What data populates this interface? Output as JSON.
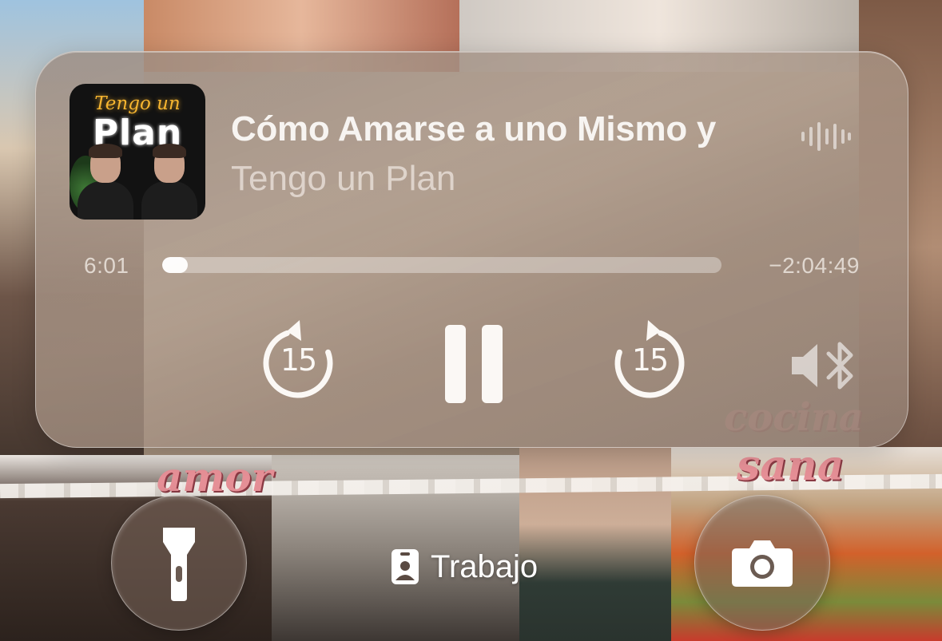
{
  "now_playing": {
    "title": "Cómo Amarse a uno Mismo y",
    "podcast": "Tengo un Plan",
    "artwork_text": {
      "top": "Tengo un",
      "bottom": "Plan"
    },
    "elapsed": "6:01",
    "remaining": "−2:04:49",
    "progress": 0.046,
    "skip_back_seconds": "15",
    "skip_forward_seconds": "15"
  },
  "wallpaper_text": {
    "left_word": "amor",
    "right_word_top": "cocina",
    "right_word_bottom": "sana"
  },
  "lock_screen": {
    "focus_mode": "Trabajo"
  },
  "icons": {
    "waveform": "audio-waveform-icon",
    "skip_back": "gobackward-15-icon",
    "pause": "pause-icon",
    "skip_forward": "goforward-15-icon",
    "output": "speaker-bluetooth-icon",
    "flashlight": "flashlight-icon",
    "focus": "person-badge-icon",
    "camera": "camera-icon"
  },
  "colors": {
    "accent_neon": "#f6b530",
    "card_tint": "#a8968a",
    "primary_text": "#f7f4f1"
  }
}
